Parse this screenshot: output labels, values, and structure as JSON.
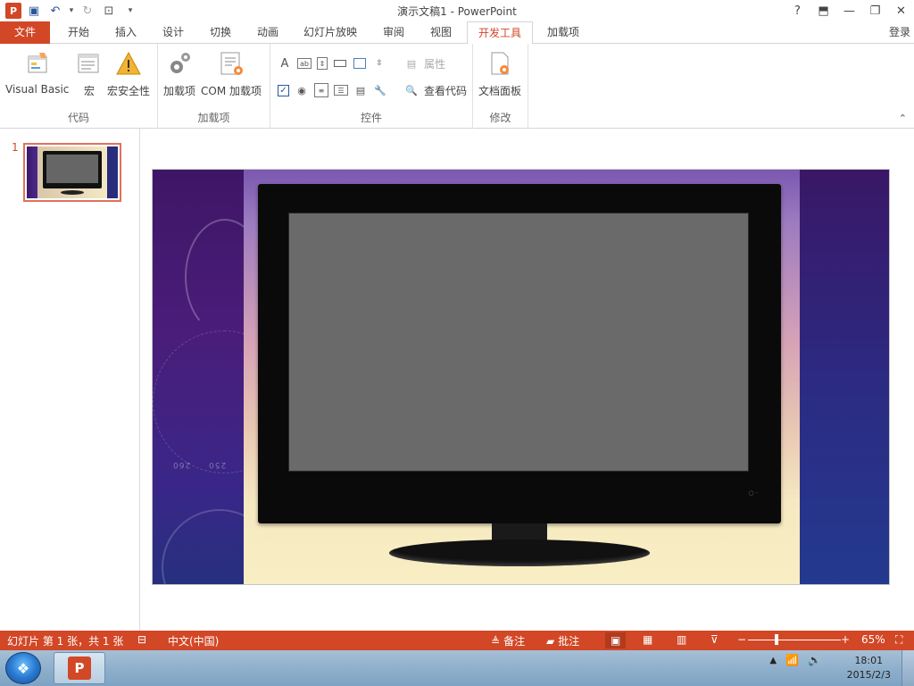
{
  "window": {
    "title": "演示文稿1 - PowerPoint",
    "help": "?",
    "minimize": "—",
    "restore": "❐",
    "close": "✕"
  },
  "qat": {
    "app": "P",
    "save": "💾",
    "undo": "↶",
    "redo": "↷",
    "present": "⊡",
    "more": "▾"
  },
  "tabs": [
    {
      "label": "文件"
    },
    {
      "label": "开始"
    },
    {
      "label": "插入"
    },
    {
      "label": "设计"
    },
    {
      "label": "切换"
    },
    {
      "label": "动画"
    },
    {
      "label": "幻灯片放映"
    },
    {
      "label": "审阅"
    },
    {
      "label": "视图"
    },
    {
      "label": "开发工具"
    },
    {
      "label": "加载项"
    }
  ],
  "login": "登录",
  "ribbon": {
    "groups": [
      {
        "label": "代码"
      },
      {
        "label": "加载项"
      },
      {
        "label": "控件"
      },
      {
        "label": "修改"
      }
    ],
    "buttons": {
      "visual_basic": "Visual Basic",
      "macro": "宏",
      "macro_security": "宏安全性",
      "addins": "加载项",
      "com_addins": "COM 加载项",
      "properties": "属性",
      "view_code": "查看代码",
      "document_panel": "文档面板"
    }
  },
  "slides": {
    "number": "1",
    "dial_a": "260",
    "dial_b": "250"
  },
  "status": {
    "slide_info": "幻灯片 第 1 张，共 1 张",
    "language": "中文(中国)",
    "notes": "备注",
    "comments": "批注",
    "zoom_out": "−",
    "zoom_in": "+",
    "zoom": "65%"
  },
  "taskbar": {
    "time": "18:01",
    "date": "2015/2/3"
  },
  "colors": {
    "accent": "#d24726"
  }
}
